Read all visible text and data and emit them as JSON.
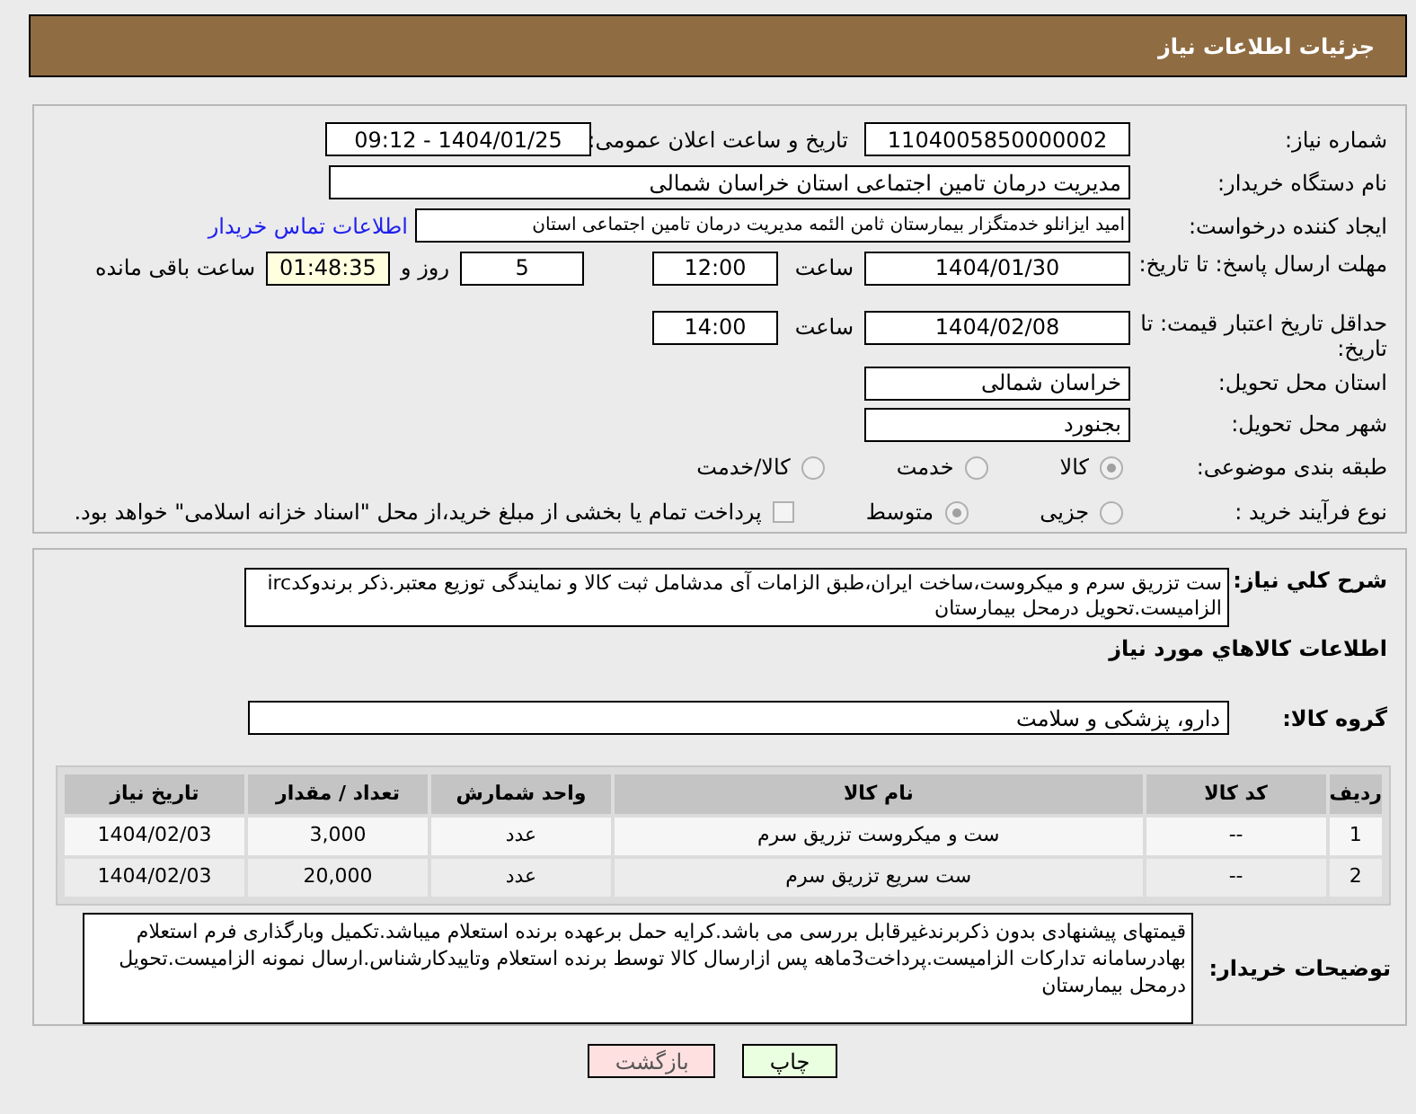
{
  "header": {
    "title": "جزئیات اطلاعات نیاز"
  },
  "need_number": {
    "label": "شماره نیاز:",
    "value": "1104005850000002"
  },
  "announce": {
    "label": "تاریخ و ساعت اعلان عمومی:",
    "value": "1404/01/25 - 09:12"
  },
  "buyer_org": {
    "label": "نام دستگاه خریدار:",
    "value": "مدیریت درمان تامین اجتماعی استان خراسان شمالی"
  },
  "requester": {
    "label": "ایجاد کننده درخواست:",
    "value": "امید ایزانلو خدمتگزار بیمارستان ثامن الئمه مدیریت درمان تامین اجتماعی استان",
    "link": "اطلاعات تماس خریدار"
  },
  "deadline": {
    "label": "مهلت ارسال پاسخ: تا تاریخ:",
    "date": "1404/01/30",
    "time_label": "ساعت",
    "time": "12:00",
    "days": "5",
    "days_label": "روز و",
    "remaining": "01:48:35",
    "remaining_label": "ساعت باقی مانده"
  },
  "validity": {
    "label": "حداقل تاریخ اعتبار قیمت: تا تاریخ:",
    "date": "1404/02/08",
    "time_label": "ساعت",
    "time": "14:00"
  },
  "province": {
    "label": "استان محل تحویل:",
    "value": "خراسان شمالی"
  },
  "city": {
    "label": "شهر محل تحویل:",
    "value": "بجنورد"
  },
  "category": {
    "label": "طبقه بندی موضوعی:",
    "options": [
      {
        "label": "کالا",
        "selected": true
      },
      {
        "label": "خدمت",
        "selected": false
      },
      {
        "label": "کالا/خدمت",
        "selected": false
      }
    ]
  },
  "process": {
    "label": "نوع فرآیند خرید :",
    "options": [
      {
        "label": "جزیی",
        "selected": false
      },
      {
        "label": "متوسط",
        "selected": true
      }
    ],
    "payment": {
      "label": "پرداخت تمام یا بخشی از مبلغ خرید،از محل \"اسناد خزانه اسلامی\" خواهد بود.",
      "checked": false
    }
  },
  "description": {
    "label": "شرح کلي نياز:",
    "value": "ست تزریق سرم و میکروست،ساخت ایران،طبق الزامات آی مدشامل ثبت کالا و نمایندگی توزیع معتبر.ذکر برندوکدirc الزامیست.تحویل درمحل بیمارستان"
  },
  "goods_heading": "اطلاعات کالاهاي مورد نياز",
  "goods_group": {
    "label": "گروه کالا:",
    "value": "دارو، پزشکی و سلامت"
  },
  "table": {
    "columns": [
      "ردیف",
      "کد کالا",
      "نام کالا",
      "واحد شمارش",
      "تعداد / مقدار",
      "تاریخ نیاز"
    ],
    "rows": [
      [
        "1",
        "--",
        "ست و میکروست تزریق سرم",
        "عدد",
        "3,000",
        "1404/02/03"
      ],
      [
        "2",
        "--",
        "ست سریع تزریق سرم",
        "عدد",
        "20,000",
        "1404/02/03"
      ]
    ]
  },
  "buyer_notes": {
    "label": "توضیحات خریدار:",
    "value": "قیمتهای پیشنهادی بدون ذکربرندغیرقابل بررسی می باشد.کرایه حمل برعهده برنده استعلام میباشد.تکمیل وبارگذاری فرم استعلام بهادرسامانه تدارکات الزامیست.پرداخت3ماهه پس ازارسال کالا توسط برنده استعلام وتاییدکارشناس.ارسال نمونه الزامیست.تحویل درمحل بیمارستان"
  },
  "buttons": [
    {
      "label": "چاپ",
      "kind": "print"
    },
    {
      "label": "بازگشت",
      "kind": "back"
    }
  ]
}
